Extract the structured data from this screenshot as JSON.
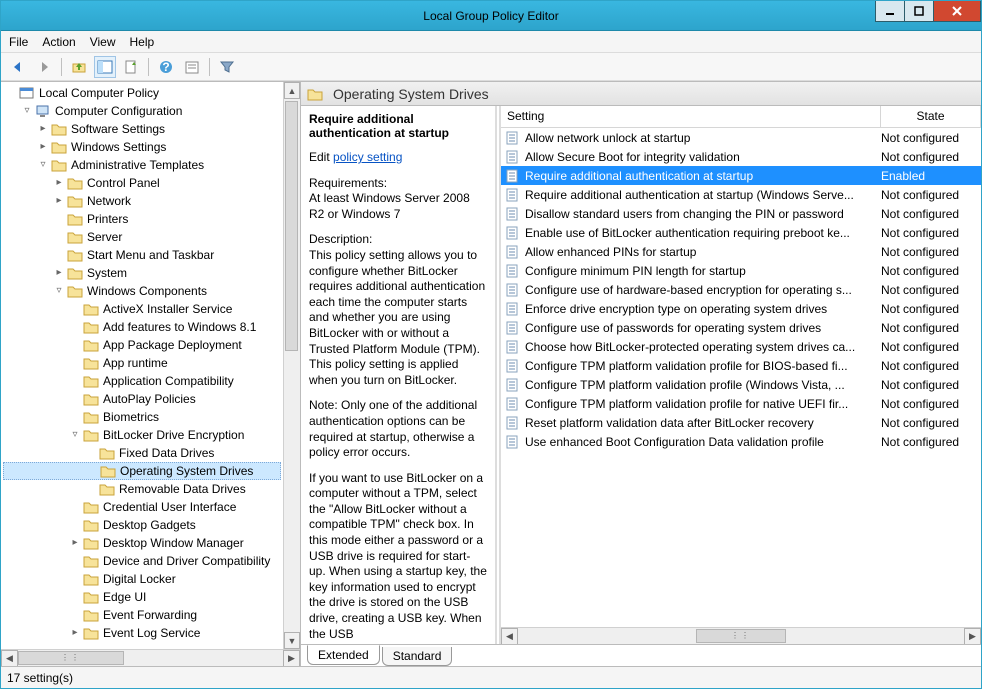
{
  "window": {
    "title": "Local Group Policy Editor"
  },
  "menu": [
    "File",
    "Action",
    "View",
    "Help"
  ],
  "tree": [
    {
      "label": "Local Computer Policy",
      "depth": 0,
      "twisty": "",
      "icon": "console"
    },
    {
      "label": "Computer Configuration",
      "depth": 1,
      "twisty": "▿",
      "icon": "comp"
    },
    {
      "label": "Software Settings",
      "depth": 2,
      "twisty": "▸",
      "icon": "folder"
    },
    {
      "label": "Windows Settings",
      "depth": 2,
      "twisty": "▸",
      "icon": "folder"
    },
    {
      "label": "Administrative Templates",
      "depth": 2,
      "twisty": "▿",
      "icon": "folder"
    },
    {
      "label": "Control Panel",
      "depth": 3,
      "twisty": "▸",
      "icon": "folder"
    },
    {
      "label": "Network",
      "depth": 3,
      "twisty": "▸",
      "icon": "folder"
    },
    {
      "label": "Printers",
      "depth": 3,
      "twisty": "",
      "icon": "folder"
    },
    {
      "label": "Server",
      "depth": 3,
      "twisty": "",
      "icon": "folder"
    },
    {
      "label": "Start Menu and Taskbar",
      "depth": 3,
      "twisty": "",
      "icon": "folder"
    },
    {
      "label": "System",
      "depth": 3,
      "twisty": "▸",
      "icon": "folder"
    },
    {
      "label": "Windows Components",
      "depth": 3,
      "twisty": "▿",
      "icon": "folder"
    },
    {
      "label": "ActiveX Installer Service",
      "depth": 4,
      "twisty": "",
      "icon": "folder"
    },
    {
      "label": "Add features to Windows 8.1",
      "depth": 4,
      "twisty": "",
      "icon": "folder"
    },
    {
      "label": "App Package Deployment",
      "depth": 4,
      "twisty": "",
      "icon": "folder"
    },
    {
      "label": "App runtime",
      "depth": 4,
      "twisty": "",
      "icon": "folder"
    },
    {
      "label": "Application Compatibility",
      "depth": 4,
      "twisty": "",
      "icon": "folder"
    },
    {
      "label": "AutoPlay Policies",
      "depth": 4,
      "twisty": "",
      "icon": "folder"
    },
    {
      "label": "Biometrics",
      "depth": 4,
      "twisty": "",
      "icon": "folder"
    },
    {
      "label": "BitLocker Drive Encryption",
      "depth": 4,
      "twisty": "▿",
      "icon": "folder"
    },
    {
      "label": "Fixed Data Drives",
      "depth": 5,
      "twisty": "",
      "icon": "folder"
    },
    {
      "label": "Operating System Drives",
      "depth": 5,
      "twisty": "",
      "icon": "folder",
      "selected": true
    },
    {
      "label": "Removable Data Drives",
      "depth": 5,
      "twisty": "",
      "icon": "folder"
    },
    {
      "label": "Credential User Interface",
      "depth": 4,
      "twisty": "",
      "icon": "folder"
    },
    {
      "label": "Desktop Gadgets",
      "depth": 4,
      "twisty": "",
      "icon": "folder"
    },
    {
      "label": "Desktop Window Manager",
      "depth": 4,
      "twisty": "▸",
      "icon": "folder"
    },
    {
      "label": "Device and Driver Compatibility",
      "depth": 4,
      "twisty": "",
      "icon": "folder"
    },
    {
      "label": "Digital Locker",
      "depth": 4,
      "twisty": "",
      "icon": "folder"
    },
    {
      "label": "Edge UI",
      "depth": 4,
      "twisty": "",
      "icon": "folder"
    },
    {
      "label": "Event Forwarding",
      "depth": 4,
      "twisty": "",
      "icon": "folder"
    },
    {
      "label": "Event Log Service",
      "depth": 4,
      "twisty": "▸",
      "icon": "folder"
    }
  ],
  "pane": {
    "heading": "Operating System Drives"
  },
  "desc": {
    "title": "Require additional authentication at startup",
    "edit_label": "Edit ",
    "edit_link": "policy setting",
    "req_h": "Requirements:",
    "req": "At least Windows Server 2008 R2 or Windows 7",
    "desc_h": "Description:",
    "p1": "This policy setting allows you to configure whether BitLocker requires additional authentication each time the computer starts and whether you are using BitLocker with or without a Trusted Platform Module (TPM). This policy setting is applied when you turn on BitLocker.",
    "p2": "Note: Only one of the additional authentication options can be required at startup, otherwise a policy error occurs.",
    "p3": "If you want to use BitLocker on a computer without a TPM, select the \"Allow BitLocker without a compatible TPM\" check box. In this mode either a password or a USB drive is required for start-up. When using a startup key, the key information used to encrypt the drive is stored on the USB drive, creating a USB key. When the USB"
  },
  "list": {
    "col_setting": "Setting",
    "col_state": "State",
    "rows": [
      {
        "name": "Allow network unlock at startup",
        "state": "Not configured"
      },
      {
        "name": "Allow Secure Boot for integrity validation",
        "state": "Not configured"
      },
      {
        "name": "Require additional authentication at startup",
        "state": "Enabled",
        "selected": true
      },
      {
        "name": "Require additional authentication at startup (Windows Serve...",
        "state": "Not configured"
      },
      {
        "name": "Disallow standard users from changing the PIN or password",
        "state": "Not configured"
      },
      {
        "name": "Enable use of BitLocker authentication requiring preboot ke...",
        "state": "Not configured"
      },
      {
        "name": "Allow enhanced PINs for startup",
        "state": "Not configured"
      },
      {
        "name": "Configure minimum PIN length for startup",
        "state": "Not configured"
      },
      {
        "name": "Configure use of hardware-based encryption for operating s...",
        "state": "Not configured"
      },
      {
        "name": "Enforce drive encryption type on operating system drives",
        "state": "Not configured"
      },
      {
        "name": "Configure use of passwords for operating system drives",
        "state": "Not configured"
      },
      {
        "name": "Choose how BitLocker-protected operating system drives ca...",
        "state": "Not configured"
      },
      {
        "name": "Configure TPM platform validation profile for BIOS-based fi...",
        "state": "Not configured"
      },
      {
        "name": "Configure TPM platform validation profile (Windows Vista, ...",
        "state": "Not configured"
      },
      {
        "name": "Configure TPM platform validation profile for native UEFI fir...",
        "state": "Not configured"
      },
      {
        "name": "Reset platform validation data after BitLocker recovery",
        "state": "Not configured"
      },
      {
        "name": "Use enhanced Boot Configuration Data validation profile",
        "state": "Not configured"
      }
    ]
  },
  "tabs": {
    "a": "Extended",
    "b": "Standard"
  },
  "status": "17 setting(s)"
}
